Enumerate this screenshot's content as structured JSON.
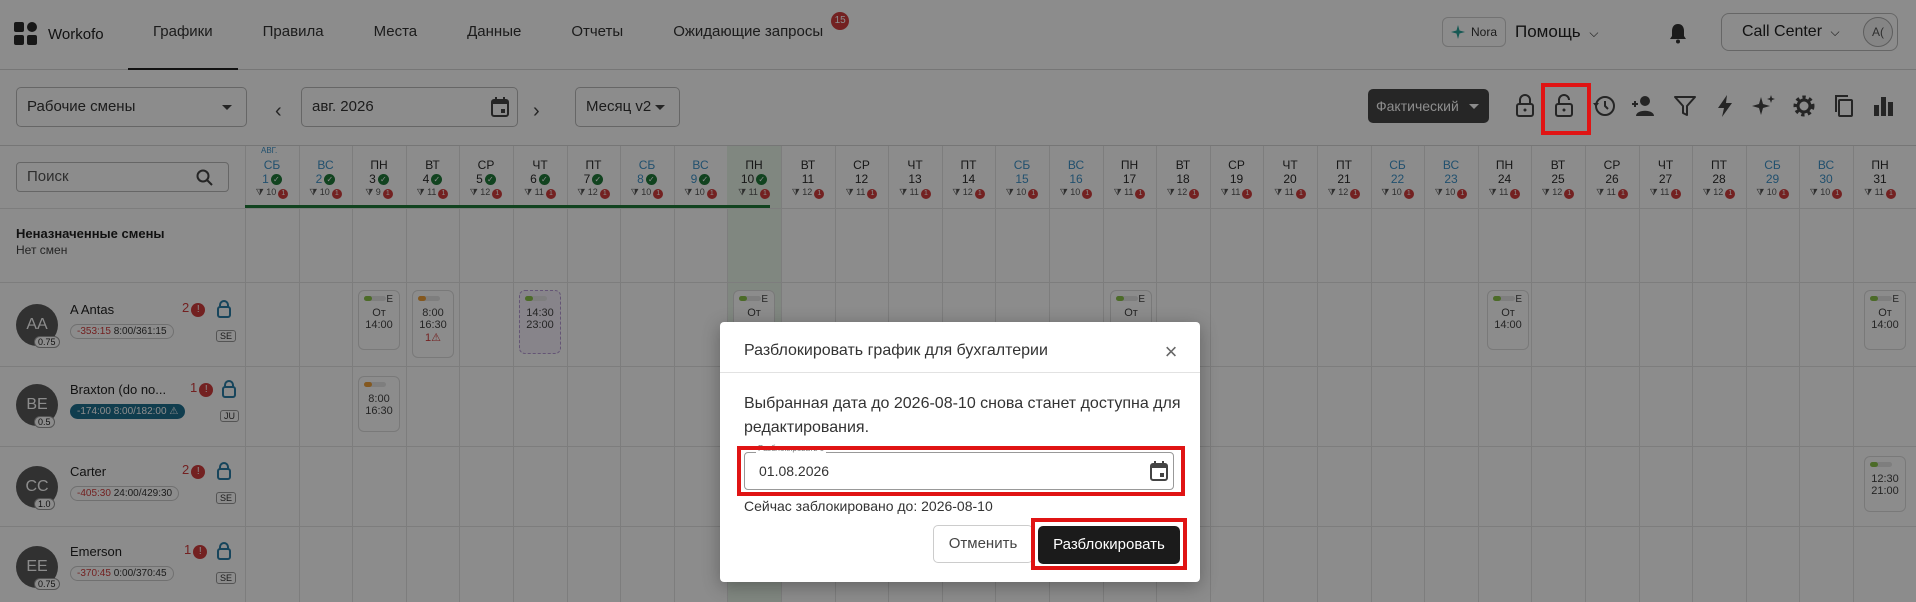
{
  "app": {
    "name": "Workofo"
  },
  "nav": {
    "tabs": [
      {
        "label": "Графики"
      },
      {
        "label": "Правила"
      },
      {
        "label": "Места"
      },
      {
        "label": "Данные"
      },
      {
        "label": "Отчеты"
      },
      {
        "label": "Ожидающие запросы",
        "badge": "15"
      }
    ],
    "nora": "Nora",
    "help": "Помощь",
    "account": "Call Center",
    "account_initials": "A("
  },
  "toolbar": {
    "view_select": "Рабочие смены",
    "period": "авг. 2026",
    "mode_select": "Месяц v2",
    "fact_button": "Фактический"
  },
  "grid": {
    "search_placeholder": "Поиск",
    "month_label": "АВГ.",
    "unassigned_title": "Неназначенные смены",
    "unassigned_sub": "Нет смен",
    "days": [
      {
        "dw": "СБ",
        "dn": "1",
        "c1": "10",
        "c2": "1"
      },
      {
        "dw": "ВС",
        "dn": "2",
        "c1": "10",
        "c2": "1"
      },
      {
        "dw": "ПН",
        "dn": "3",
        "c1": "9",
        "c2": "1"
      },
      {
        "dw": "ВТ",
        "dn": "4",
        "c1": "11",
        "c2": "1"
      },
      {
        "dw": "СР",
        "dn": "5",
        "c1": "12",
        "c2": "1"
      },
      {
        "dw": "ЧТ",
        "dn": "6",
        "c1": "11",
        "c2": "1"
      },
      {
        "dw": "ПТ",
        "dn": "7",
        "c1": "12",
        "c2": "1"
      },
      {
        "dw": "СБ",
        "dn": "8",
        "c1": "10",
        "c2": "1"
      },
      {
        "dw": "ВС",
        "dn": "9",
        "c1": "10",
        "c2": "1"
      },
      {
        "dw": "ПН",
        "dn": "10",
        "c1": "11",
        "c2": "1"
      },
      {
        "dw": "ВТ",
        "dn": "11",
        "c1": "12",
        "c2": "1"
      },
      {
        "dw": "СР",
        "dn": "12",
        "c1": "11",
        "c2": "1"
      },
      {
        "dw": "ЧТ",
        "dn": "13",
        "c1": "11",
        "c2": "1"
      },
      {
        "dw": "ПТ",
        "dn": "14",
        "c1": "12",
        "c2": "1"
      },
      {
        "dw": "СБ",
        "dn": "15",
        "c1": "10",
        "c2": "1"
      },
      {
        "dw": "ВС",
        "dn": "16",
        "c1": "10",
        "c2": "1"
      },
      {
        "dw": "ПН",
        "dn": "17",
        "c1": "11",
        "c2": "1"
      },
      {
        "dw": "ВТ",
        "dn": "18",
        "c1": "12",
        "c2": "1"
      },
      {
        "dw": "СР",
        "dn": "19",
        "c1": "11",
        "c2": "1"
      },
      {
        "dw": "ЧТ",
        "dn": "20",
        "c1": "11",
        "c2": "1"
      },
      {
        "dw": "ПТ",
        "dn": "21",
        "c1": "12",
        "c2": "1"
      },
      {
        "dw": "СБ",
        "dn": "22",
        "c1": "10",
        "c2": "1"
      },
      {
        "dw": "ВС",
        "dn": "23",
        "c1": "10",
        "c2": "1"
      },
      {
        "dw": "ПН",
        "dn": "24",
        "c1": "11",
        "c2": "1"
      },
      {
        "dw": "ВТ",
        "dn": "25",
        "c1": "12",
        "c2": "1"
      },
      {
        "dw": "СР",
        "dn": "26",
        "c1": "11",
        "c2": "1"
      },
      {
        "dw": "ЧТ",
        "dn": "27",
        "c1": "11",
        "c2": "1"
      },
      {
        "dw": "ПТ",
        "dn": "28",
        "c1": "12",
        "c2": "1"
      },
      {
        "dw": "СБ",
        "dn": "29",
        "c1": "10",
        "c2": "1"
      },
      {
        "dw": "ВС",
        "dn": "30",
        "c1": "10",
        "c2": "1"
      },
      {
        "dw": "ПН",
        "dn": "31",
        "c1": "11",
        "c2": "1"
      }
    ],
    "employees": [
      {
        "initials": "AA",
        "fte": "0.75",
        "name": "A Antas",
        "warn": "2",
        "neg": "-353:15",
        "hours": "8:00/361:15",
        "tag": "SE"
      },
      {
        "initials": "BE",
        "fte": "0.5",
        "name": "Braxton (do no...",
        "warn": "1",
        "neg": "-174:00",
        "hours": "8:00/182:00",
        "tag": "JU"
      },
      {
        "initials": "CC",
        "fte": "1.0",
        "name": "Carter",
        "warn": "2",
        "neg": "-405:30",
        "hours": "24:00/429:30",
        "tag": "SE"
      },
      {
        "initials": "EE",
        "fte": "0.75",
        "name": "Emerson",
        "warn": "1",
        "neg": "-370:45",
        "hours": "0:00/370:45",
        "tag": "SE"
      }
    ],
    "shifts": {
      "from_label": "От",
      "from_time": "14:00",
      "e_tag": "E",
      "s1_start": "8:00",
      "s1_end": "16:30",
      "s1_warn": "1",
      "s2_start": "14:30",
      "s2_end": "23:00",
      "s3_start": "8:00",
      "s3_end": "16:30",
      "s4_start": "12:30",
      "s4_end": "21:00"
    }
  },
  "modal": {
    "title": "Разблокировать график для бухгалтерии",
    "message": "Выбранная дата до 2026-08-10 снова станет доступна для редактирования.",
    "field_label": "Разблокировать с",
    "field_value": "01.08.2026",
    "current_lock": "Сейчас заблокировано до: 2026-08-10",
    "cancel": "Отменить",
    "confirm": "Разблокировать"
  },
  "colors": {
    "highlight": "#e01414",
    "accent_dark": "#1b1b1b",
    "weekend": "#3e93c9",
    "warning": "#d23d3d"
  }
}
